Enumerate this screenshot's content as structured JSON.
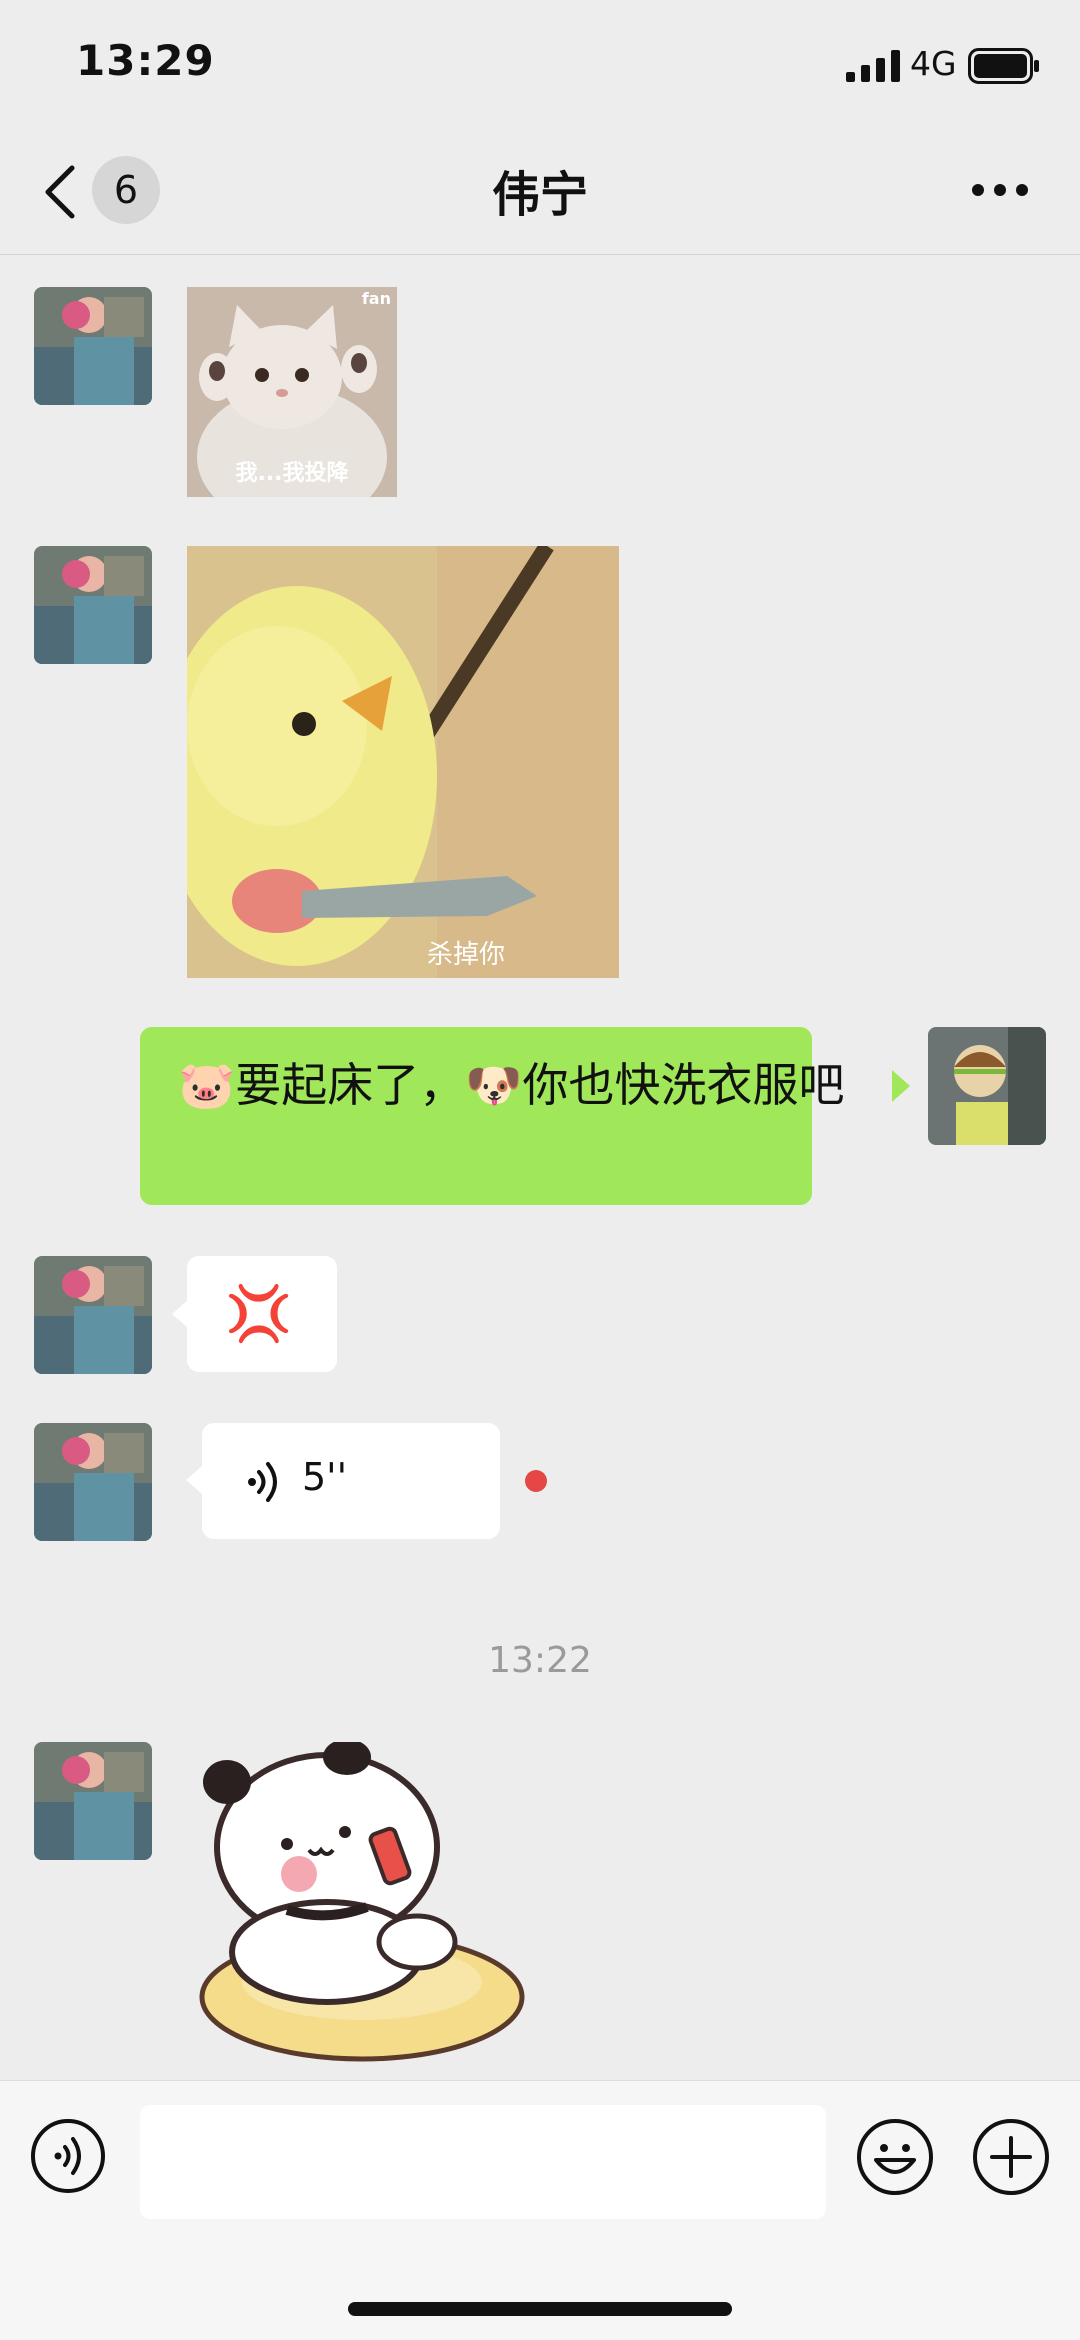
{
  "status_bar": {
    "time": "13:29",
    "network": "4G",
    "icons": [
      "signal-icon",
      "battery-icon"
    ]
  },
  "nav": {
    "back_icon": "chevron-left-icon",
    "unread_count": "6",
    "title": "伟宁",
    "more_icon": "more-dots-icon"
  },
  "messages": [
    {
      "side": "left",
      "type": "sticker",
      "caption": "我...我投降",
      "watermark": "fan"
    },
    {
      "side": "left",
      "type": "sticker",
      "caption": "杀掉你"
    },
    {
      "side": "right",
      "type": "text",
      "text": "🐷要起床了，🐶你也快洗衣服吧"
    },
    {
      "side": "left",
      "type": "emoji",
      "emoji": "💢"
    },
    {
      "side": "left",
      "type": "voice",
      "duration": "5''",
      "unread": true
    },
    {
      "side": "left",
      "type": "sticker",
      "caption": ""
    }
  ],
  "timestamp": "13:22",
  "input_bar": {
    "value": "",
    "voice_icon": "voice-icon",
    "emoji_icon": "emoji-icon",
    "plus_icon": "plus-icon"
  },
  "colors": {
    "background": "#ededed",
    "sent_bubble": "#a0e75a",
    "received_bubble": "#ffffff",
    "unread_dot": "#e54646"
  }
}
